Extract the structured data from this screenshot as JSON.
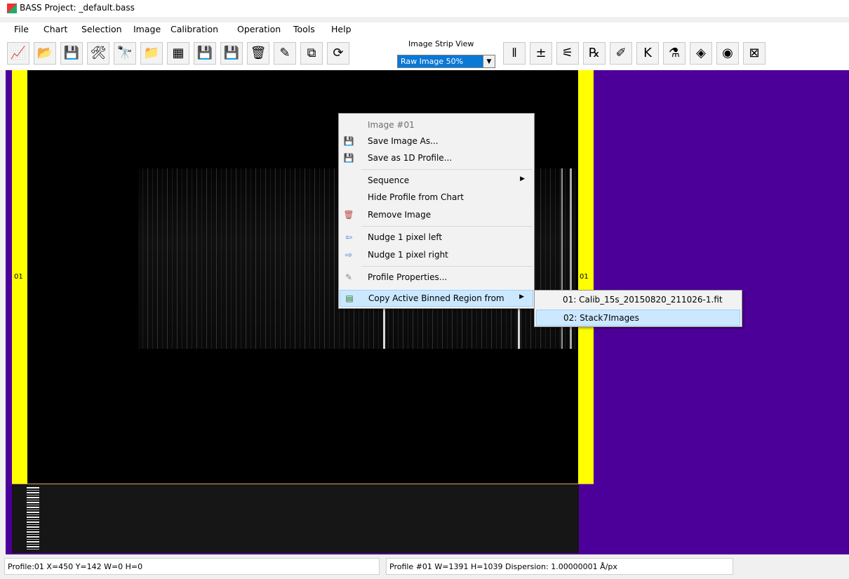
{
  "window": {
    "title": "BASS Project: _default.bass"
  },
  "menu": [
    "File",
    "Chart",
    "Selection",
    "Image",
    "Calibration",
    "Operation",
    "Tools",
    "Help"
  ],
  "toolbar": {
    "buttons": [
      {
        "name": "new-chart-icon",
        "glyph": "📈"
      },
      {
        "name": "open-chart-icon",
        "glyph": "📂"
      },
      {
        "name": "save-chart-icon",
        "glyph": "💾"
      },
      {
        "name": "tools-icon",
        "glyph": "🛠"
      },
      {
        "name": "binoculars-icon",
        "glyph": "🔭"
      },
      {
        "name": "open-folder-icon",
        "glyph": "📁"
      },
      {
        "name": "camera-strip-icon",
        "glyph": "▦"
      },
      {
        "name": "save-icon",
        "glyph": "💾"
      },
      {
        "name": "save-1d-icon",
        "glyph": "💾"
      },
      {
        "name": "delete-icon",
        "glyph": "🗑"
      },
      {
        "name": "wand-icon",
        "glyph": "✎"
      },
      {
        "name": "crop-profile-icon",
        "glyph": "⧉"
      },
      {
        "name": "refresh-icon",
        "glyph": "⟳"
      }
    ],
    "right_buttons": [
      {
        "name": "numbered-profile-icon",
        "glyph": "𝍪"
      },
      {
        "name": "math-operations-icon",
        "glyph": "±"
      },
      {
        "name": "compass-icon",
        "glyph": "⚟"
      },
      {
        "name": "reference-profile-icon",
        "glyph": "℞"
      },
      {
        "name": "pen-chart-icon",
        "glyph": "✐"
      },
      {
        "name": "k-profile-icon",
        "glyph": "K"
      },
      {
        "name": "flask-icon",
        "glyph": "⚗"
      },
      {
        "name": "label-icon",
        "glyph": "◈"
      },
      {
        "name": "film-reel-icon",
        "glyph": "◉"
      },
      {
        "name": "excel-export-icon",
        "glyph": "⊠"
      }
    ],
    "strip_view_label": "Image Strip View",
    "strip_view_value": "Raw Image 50%"
  },
  "image": {
    "left_label": "01",
    "right_label": "01"
  },
  "context_menu": {
    "items": [
      {
        "label": "Image #01",
        "disabled": true,
        "icon": ""
      },
      {
        "label": "Save Image As...",
        "icon": "💾"
      },
      {
        "label": "Save as 1D Profile...",
        "icon": "💾"
      },
      {
        "label": "Sequence",
        "submenu": true
      },
      {
        "label": "Hide Profile from Chart"
      },
      {
        "label": "Remove Image",
        "icon": "🗑"
      },
      {
        "label": "Nudge 1 pixel left",
        "icon": "⇦"
      },
      {
        "label": "Nudge 1 pixel right",
        "icon": "⇨"
      },
      {
        "label": "Profile Properties...",
        "icon": "✎"
      },
      {
        "label": "Copy Active Binned Region from",
        "icon": "▤",
        "submenu": true
      }
    ],
    "submenu_arrow": "▶",
    "submenu_items": [
      {
        "label": "01: Calib_15s_20150820_211026-1.fit"
      },
      {
        "label": "02: Stack7Images"
      }
    ]
  },
  "status": {
    "left": "Profile:01  X=450 Y=142 W=0 H=0",
    "right": "Profile #01 W=1391 H=1039  Dispersion: 1.00000001 Å/px"
  }
}
